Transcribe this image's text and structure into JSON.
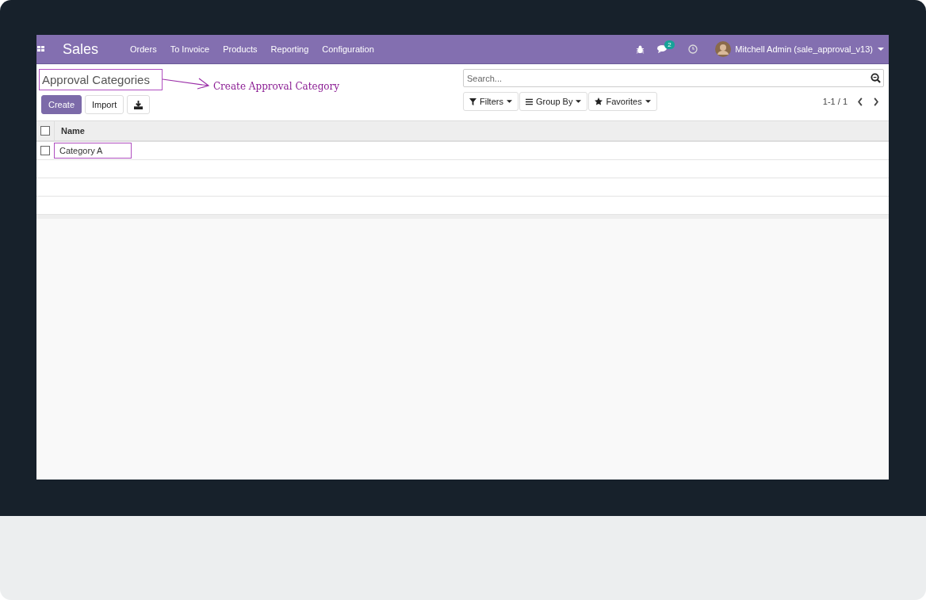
{
  "navbar": {
    "app_name": "Sales",
    "menu": [
      "Orders",
      "To Invoice",
      "Products",
      "Reporting",
      "Configuration"
    ],
    "messages_badge": "2",
    "user": "Mitchell Admin (sale_approval_v13)"
  },
  "control_panel": {
    "title": "Approval Categories",
    "buttons": [
      "Create",
      "Import"
    ],
    "search": {
      "placeholder": "Search..."
    },
    "filters": [
      {
        "kind": "filter",
        "label": "Filters"
      },
      {
        "kind": "group",
        "label": "Group By"
      },
      {
        "kind": "favorite",
        "label": "Favorites"
      }
    ],
    "pager": "1-1 / 1"
  },
  "annotation": {
    "text": "Create Approval Category"
  },
  "table": {
    "columns": [
      "Name"
    ],
    "header_checked": false,
    "rows": [
      {
        "name": "Category A",
        "checked": false,
        "highlighted": true
      }
    ]
  }
}
